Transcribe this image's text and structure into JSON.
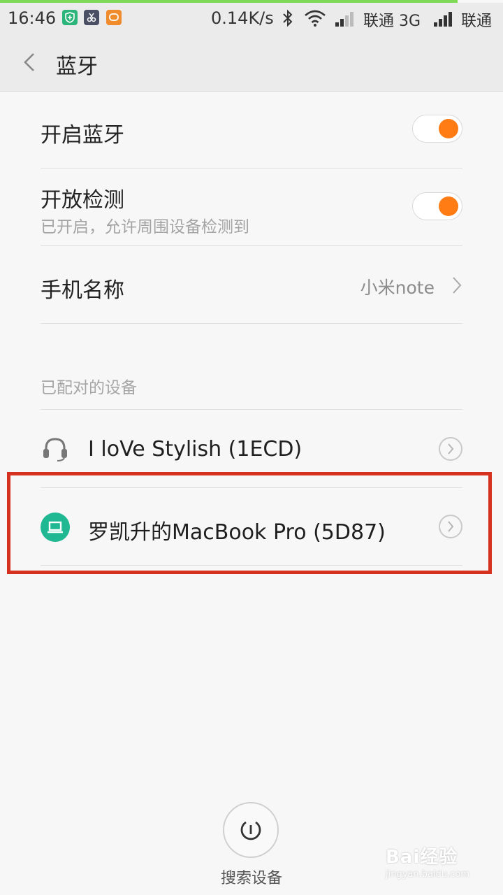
{
  "status_bar": {
    "time": "16:46",
    "speed": "0.14K/s",
    "carrier1": "联通 3G",
    "carrier2": "联通"
  },
  "header": {
    "title": "蓝牙"
  },
  "settings": {
    "bluetooth": {
      "label": "开启蓝牙",
      "enabled": true
    },
    "discoverable": {
      "label": "开放检测",
      "subtitle": "已开启，允许周围设备检测到",
      "enabled": true
    },
    "phone_name": {
      "label": "手机名称",
      "value": "小米note"
    }
  },
  "paired": {
    "header": "已配对的设备",
    "devices": [
      {
        "name": "I loVe Stylish (1ECD)",
        "icon": "headset-icon"
      },
      {
        "name": "罗凯升的MacBook Pro (5D87)",
        "icon": "laptop-icon"
      }
    ]
  },
  "search": {
    "label": "搜索设备"
  },
  "watermark": {
    "logo": "Bai经验",
    "url": "jingyan.baidu.com"
  },
  "colors": {
    "accent": "#ff7b14",
    "teal": "#1fb893",
    "highlight": "#d6311e"
  }
}
